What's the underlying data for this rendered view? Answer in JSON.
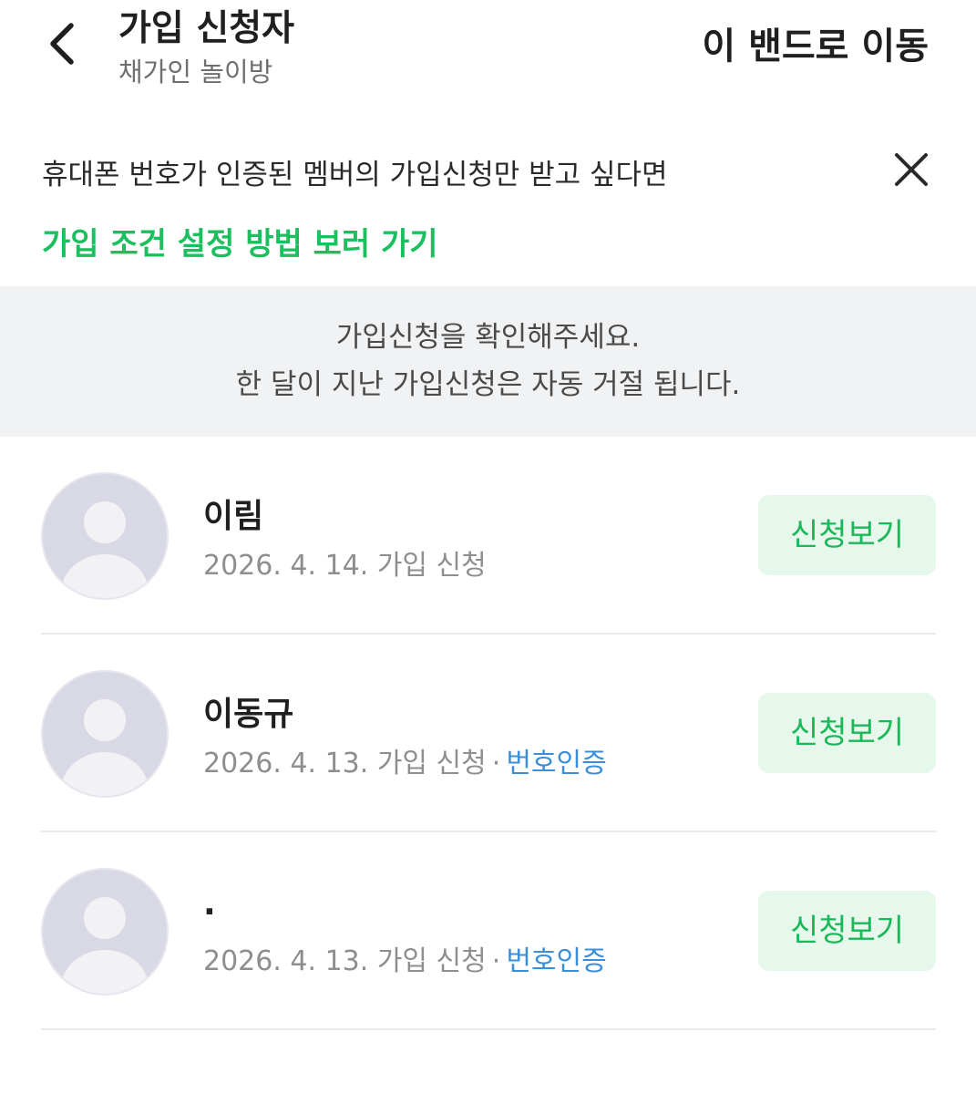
{
  "header": {
    "title": "가입 신청자",
    "subtitle": "채가인 놀이방",
    "action_label": "이 밴드로 이동"
  },
  "notice": {
    "text": "휴대폰 번호가 인증된 멤버의 가입신청만 받고 싶다면",
    "link_label": "가입 조건 설정 방법 보러 가기"
  },
  "info": {
    "line1": "가입신청을 확인해주세요.",
    "line2": "한 달이 지난 가입신청은 자동 거절 됩니다."
  },
  "applicants": [
    {
      "name": "이림",
      "date": "2026. 4. 14. 가입 신청",
      "verified": "",
      "button": "신청보기"
    },
    {
      "name": "이동규",
      "date": "2026. 4. 13. 가입 신청",
      "verified": "번호인증",
      "button": "신청보기"
    },
    {
      "name": ".",
      "date": "2026. 4. 13. 가입 신청",
      "verified": "번호인증",
      "button": "신청보기"
    }
  ],
  "separator": "·",
  "colors": {
    "accent_green": "#1bbf5e",
    "button_bg": "#e6f8ec",
    "verified_blue": "#3b8fd8",
    "info_bg": "#f1f2f4",
    "avatar_bg": "#d8d9e4"
  },
  "icons": {
    "back": "chevron-left-icon",
    "close": "close-icon",
    "avatar": "default-profile-icon"
  }
}
